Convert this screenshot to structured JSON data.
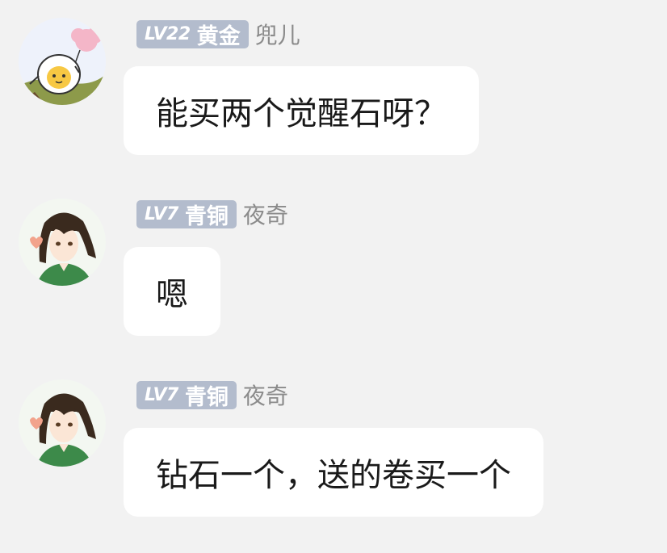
{
  "messages": [
    {
      "level": "LV22",
      "rank": "黄金",
      "nickname": "兜儿",
      "avatar_icon": "egg-character-avatar-icon",
      "text": "能买两个觉醒石呀？"
    },
    {
      "level": "LV7",
      "rank": "青铜",
      "nickname": "夜奇",
      "avatar_icon": "anime-girl-avatar-icon",
      "text": "嗯"
    },
    {
      "level": "LV7",
      "rank": "青铜",
      "nickname": "夜奇",
      "avatar_icon": "anime-girl-avatar-icon",
      "text": "钻石一个，送的卷买一个"
    }
  ],
  "colors": {
    "background": "#f2f2f2",
    "badge": "#b3bccd",
    "bubble": "#ffffff",
    "nickname": "#8b8b8b"
  }
}
